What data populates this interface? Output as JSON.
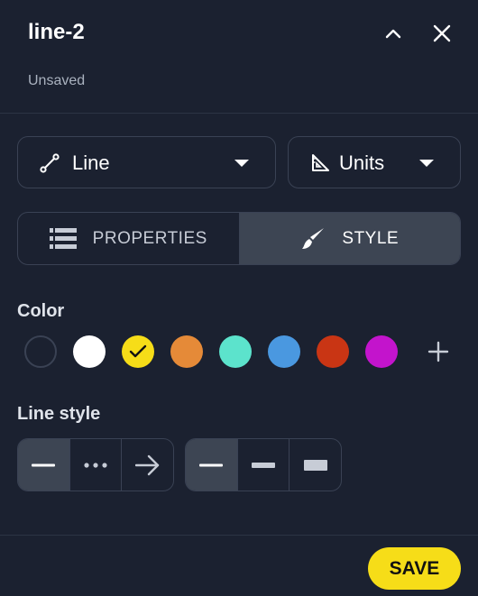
{
  "header": {
    "title": "line-2",
    "status": "Unsaved"
  },
  "type_dropdown": {
    "selected": "Line",
    "icon": "line-tool-icon"
  },
  "units_dropdown": {
    "selected": "Units",
    "icon": "set-square-icon"
  },
  "tabs": [
    {
      "label": "PROPERTIES",
      "icon": "list-icon",
      "active": false
    },
    {
      "label": "STYLE",
      "icon": "paintbrush-icon",
      "active": true
    }
  ],
  "color_section": {
    "label": "Color",
    "swatches": [
      {
        "name": "none",
        "color": "#1b2130",
        "selected": false
      },
      {
        "name": "white",
        "color": "#ffffff",
        "selected": false
      },
      {
        "name": "yellow",
        "color": "#f6dd18",
        "selected": true
      },
      {
        "name": "orange",
        "color": "#e58a38",
        "selected": false
      },
      {
        "name": "teal",
        "color": "#5ce3cc",
        "selected": false
      },
      {
        "name": "blue",
        "color": "#4a98e0",
        "selected": false
      },
      {
        "name": "red",
        "color": "#c93514",
        "selected": false
      },
      {
        "name": "magenta",
        "color": "#c314cc",
        "selected": false
      }
    ],
    "add_icon": "plus-icon"
  },
  "line_style_section": {
    "label": "Line style",
    "dash_options": [
      {
        "name": "solid",
        "active": true
      },
      {
        "name": "dotted",
        "active": false
      },
      {
        "name": "arrow",
        "active": false
      }
    ],
    "weight_options": [
      {
        "name": "thin",
        "active": true
      },
      {
        "name": "medium",
        "active": false
      },
      {
        "name": "thick",
        "active": false
      }
    ]
  },
  "footer": {
    "save_label": "SAVE"
  },
  "colors": {
    "background": "#1b2130",
    "accent": "#f6dd18",
    "active_segment": "#3d4553",
    "border": "#3a4254"
  }
}
